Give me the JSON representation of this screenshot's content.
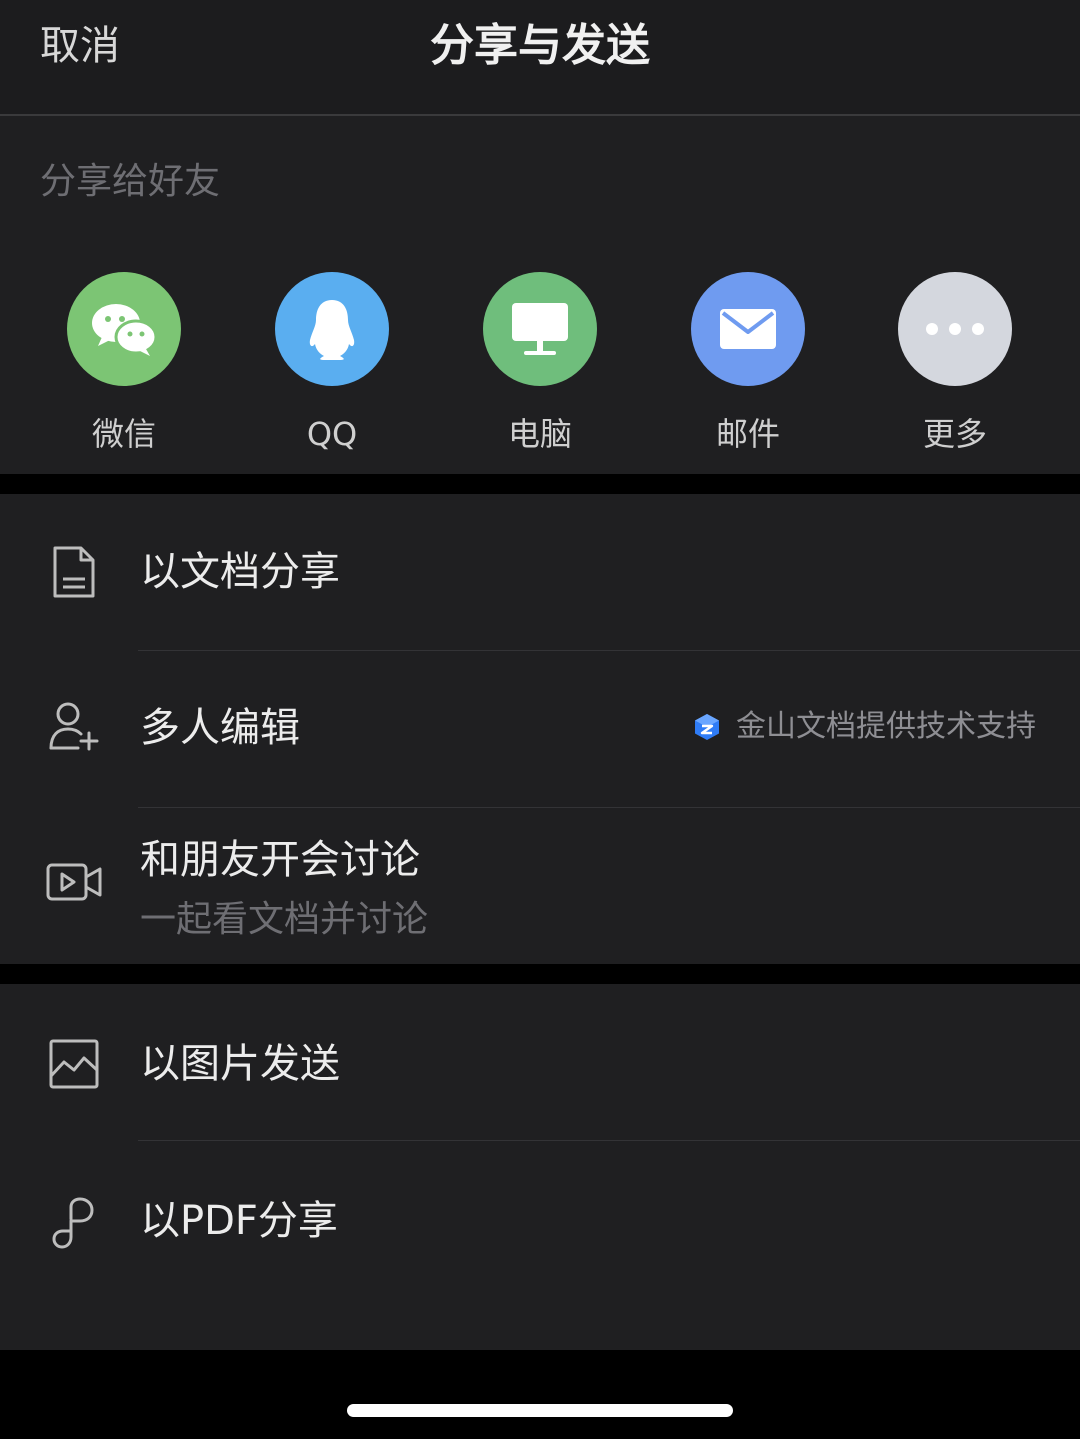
{
  "header": {
    "cancel_label": "取消",
    "title": "分享与发送"
  },
  "share": {
    "heading": "分享给好友",
    "items": [
      {
        "label": "微信",
        "icon": "wechat-icon",
        "color": "#7cc574"
      },
      {
        "label": "QQ",
        "icon": "qq-penguin-icon",
        "color": "#5aaef0"
      },
      {
        "label": "电脑",
        "icon": "monitor-icon",
        "color": "#6fbe7c"
      },
      {
        "label": "邮件",
        "icon": "mail-icon",
        "color": "#6f9bf0"
      },
      {
        "label": "更多",
        "icon": "more-dots-icon",
        "color": "#d4d7de"
      }
    ]
  },
  "actions_group1": {
    "share_as_doc": "以文档分享",
    "multi_edit": "多人编辑",
    "support_text": "金山文档提供技术支持",
    "meeting_title": "和朋友开会讨论",
    "meeting_subtitle": "一起看文档并讨论"
  },
  "actions_group2": {
    "send_as_image": "以图片发送",
    "share_as_pdf": "以PDF分享"
  },
  "colors": {
    "background": "#1f1f21",
    "header": "#1c1c1e",
    "accent_blue": "#2f7cf6"
  }
}
